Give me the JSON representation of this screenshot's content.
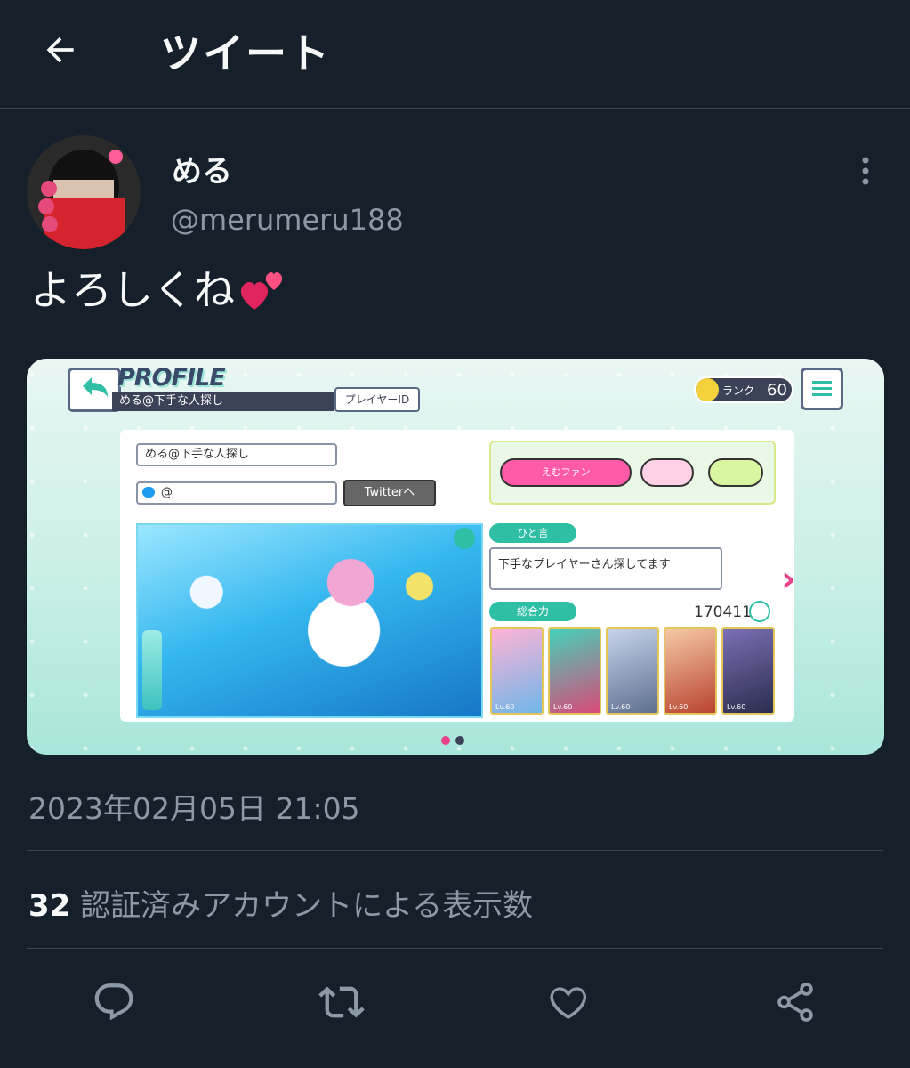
{
  "header": {
    "title": "ツイート"
  },
  "tweet": {
    "author_name": "める",
    "author_handle": "@merumeru188",
    "text": "よろしくね",
    "timestamp": "2023年02月05日 21:05",
    "views_count": "32",
    "views_label": "認証済みアカウントによる表示数"
  },
  "media": {
    "profile_title": "PROFILE",
    "profile_name_bar": "める@下手な人探し",
    "player_id_button": "プレイヤーID",
    "rank_label": "ランク",
    "rank_value": "60",
    "name_field": "める@下手な人探し",
    "twitter_field": "@",
    "twitter_button": "Twitterへ",
    "fan_label": "えむファン",
    "hitokoto_label": "ひと言",
    "hitokoto_text": "下手なプレイヤーさん探してます",
    "total_power_label": "総合力",
    "total_power_value": "170411",
    "card_levels": [
      "Lv.60",
      "Lv.60",
      "Lv.60",
      "Lv.60",
      "Lv.60"
    ]
  },
  "colors": {
    "background": "#15202b",
    "text_primary": "#f7f9f9",
    "text_secondary": "#8b98a5",
    "divider": "#38444d",
    "heart": "#e0245e"
  },
  "icons": {
    "back": "back-arrow-icon",
    "more": "more-vertical-icon",
    "reply": "reply-icon",
    "retweet": "retweet-icon",
    "like": "heart-icon",
    "share": "share-icon"
  }
}
